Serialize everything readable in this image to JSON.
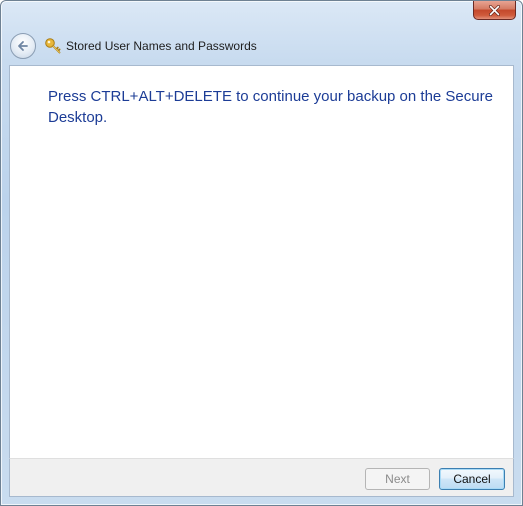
{
  "window": {
    "close_label": "Close"
  },
  "nav": {
    "title": "Stored User Names and Passwords",
    "back_icon": "back-arrow-icon",
    "app_icon": "key-icon"
  },
  "content": {
    "instruction": "Press CTRL+ALT+DELETE to continue your backup on the Secure Desktop."
  },
  "footer": {
    "next_label": "Next",
    "next_enabled": false,
    "cancel_label": "Cancel"
  },
  "colors": {
    "instruction_text": "#1c3c96",
    "close_button": "#c4482c",
    "frame": "#bcd3ec"
  }
}
